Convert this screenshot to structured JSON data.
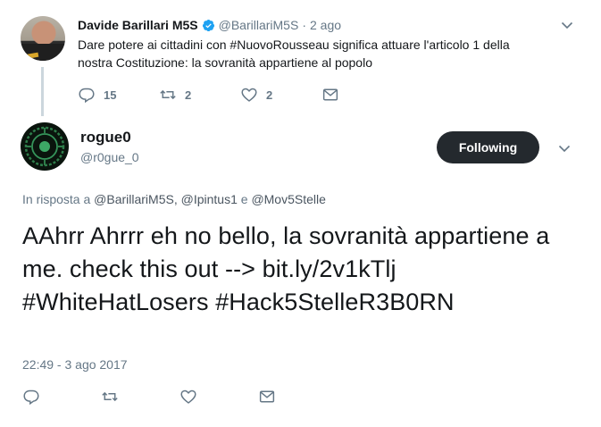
{
  "parent_tweet": {
    "author_name": "Davide Barillari M5S",
    "author_handle": "@BarillariM5S",
    "separator": "·",
    "time_ago": "2 ago",
    "text": "Dare potere ai cittadini con #NuovoRousseau  significa attuare l'articolo 1 della nostra Costituzione: la sovranità appartiene al popolo",
    "actions": {
      "reply_count": "15",
      "retweet_count": "2",
      "like_count": "2"
    },
    "icons": {
      "verified": "verified-badge-icon",
      "more": "chevron-down-icon",
      "reply": "reply-icon",
      "retweet": "retweet-icon",
      "like": "heart-icon",
      "message": "envelope-icon"
    }
  },
  "main_tweet": {
    "author_name": "rogue0",
    "author_handle": "@r0gue_0",
    "follow_button_label": "Following",
    "reply_to_prefix": "In risposta a ",
    "reply_to_mentions": "@BarillariM5S, @Ipintus1",
    "reply_to_joiner": " e ",
    "reply_to_last": "@Mov5Stelle",
    "text": "AAhrr Ahrrr eh no bello, la sovranità appartiene a me. check this out --> bit.ly/2v1kTlj  #WhiteHatLosers #Hack5StelleR3B0RN",
    "timestamp": "22:49 - 3 ago 2017"
  },
  "colors": {
    "text_primary": "#14171a",
    "text_secondary": "#657786",
    "verified_blue": "#1da1f2",
    "follow_button_bg": "#24292e",
    "thread_line": "#ccd6dd"
  }
}
